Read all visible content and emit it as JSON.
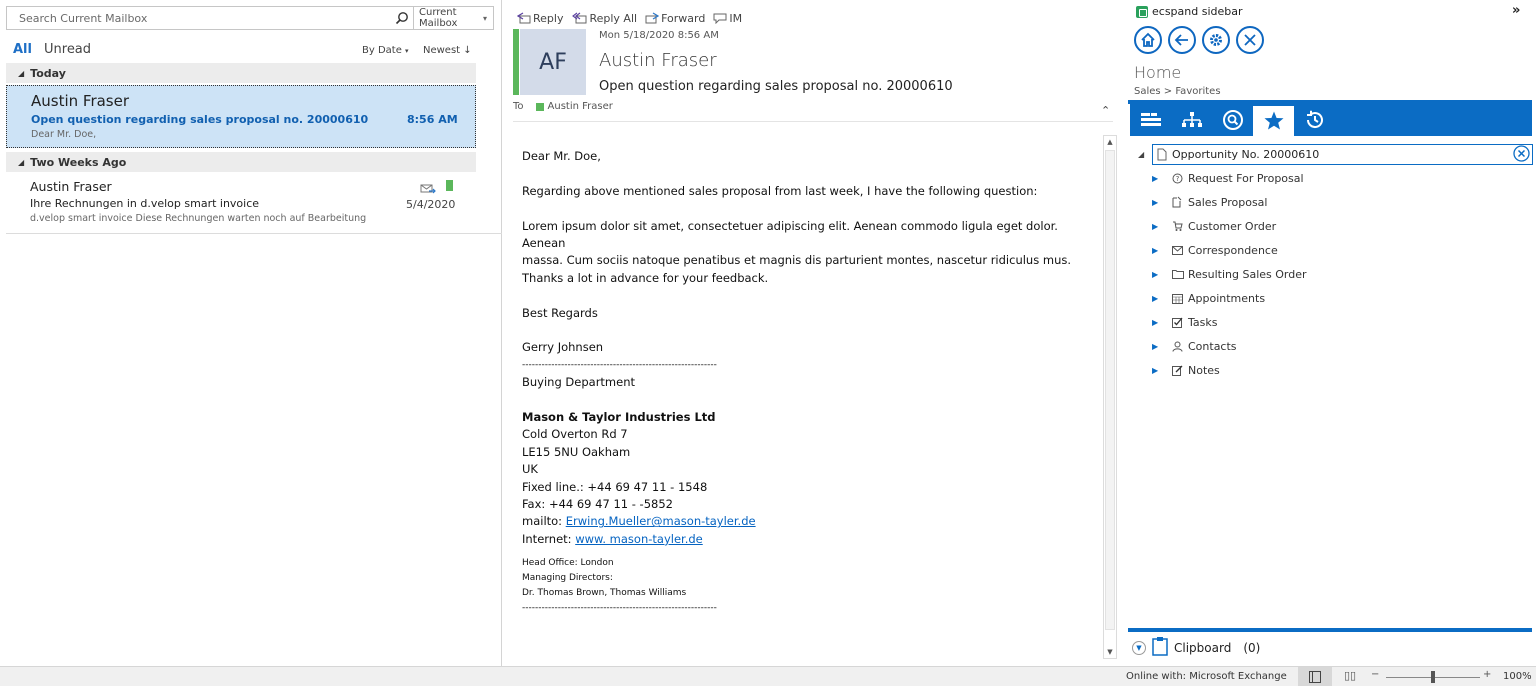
{
  "search": {
    "placeholder": "Search Current Mailbox",
    "scope": "Current Mailbox"
  },
  "filters": {
    "all": "All",
    "unread": "Unread",
    "sort": "By Date",
    "order": "Newest"
  },
  "groups": {
    "today": "Today",
    "two_weeks": "Two Weeks Ago"
  },
  "messages": [
    {
      "sender": "Austin Fraser",
      "subject": "Open question regarding sales proposal no. 20000610",
      "time": "8:56 AM",
      "preview": "Dear Mr. Doe,"
    },
    {
      "sender": "Austin Fraser",
      "subject": "Ihre Rechnungen in d.velop smart invoice",
      "time": "5/4/2020",
      "preview": "d.velop smart invoice  Diese Rechnungen warten noch auf Bearbeitung"
    }
  ],
  "toolbar": {
    "reply": "Reply",
    "reply_all": "Reply All",
    "forward": "Forward",
    "im": "IM"
  },
  "header": {
    "initials": "AF",
    "date": "Mon 5/18/2020 8:56 AM",
    "from": "Austin Fraser",
    "subject": "Open question regarding sales proposal no. 20000610",
    "to_label": "To",
    "to": "Austin Fraser"
  },
  "body": {
    "greeting": "Dear Mr. Doe,",
    "line1": "Regarding above mentioned sales proposal from last week, I have the following question:",
    "p2a": "Lorem ipsum dolor sit amet, consectetuer adipiscing elit. Aenean commodo ligula eget dolor. Aenean",
    "p2b": "massa. Cum sociis natoque penatibus et magnis dis parturient montes, nascetur ridiculus mus.",
    "p2c": "Thanks a lot in advance for your feedback.",
    "regards": "Best Regards",
    "name": "Gerry Johnsen",
    "dashes": "------------------------------------------------------------",
    "dept": "Buying Department",
    "company": "Mason & Taylor Industries Ltd",
    "addr1": "Cold Overton Rd 7",
    "addr2": "LE15 5NU Oakham",
    "addr3": "UK",
    "phone": "Fixed line.: +44 69 47 11 - 1548",
    "fax": "Fax: +44 69 47 11 - -5852",
    "mail_label": "mailto: ",
    "mail": "Erwing.Mueller@mason-tayler.de",
    "web_label": "Internet: ",
    "web": "www. mason-tayler.de",
    "office": "Head Office: London",
    "md_label": "Managing Directors:",
    "md": "Dr. Thomas Brown, Thomas Williams"
  },
  "sidebar": {
    "title": "ecspand sidebar",
    "home": "Home",
    "breadcrumb": "Sales > Favorites",
    "root": "Opportunity No. 20000610",
    "items": [
      {
        "label": "Request For Proposal"
      },
      {
        "label": "Sales Proposal"
      },
      {
        "label": "Customer Order"
      },
      {
        "label": "Correspondence"
      },
      {
        "label": "Resulting Sales Order"
      },
      {
        "label": "Appointments"
      },
      {
        "label": "Tasks"
      },
      {
        "label": "Contacts"
      },
      {
        "label": "Notes"
      }
    ],
    "clipboard": "Clipboard",
    "clipboard_count": "(0)"
  },
  "status": {
    "text": "Online with: Microsoft Exchange",
    "zoom": "100%"
  },
  "colors": {
    "accent": "#0b6cc4",
    "category_green": "#5bb75b",
    "selection": "#cde3f6"
  }
}
